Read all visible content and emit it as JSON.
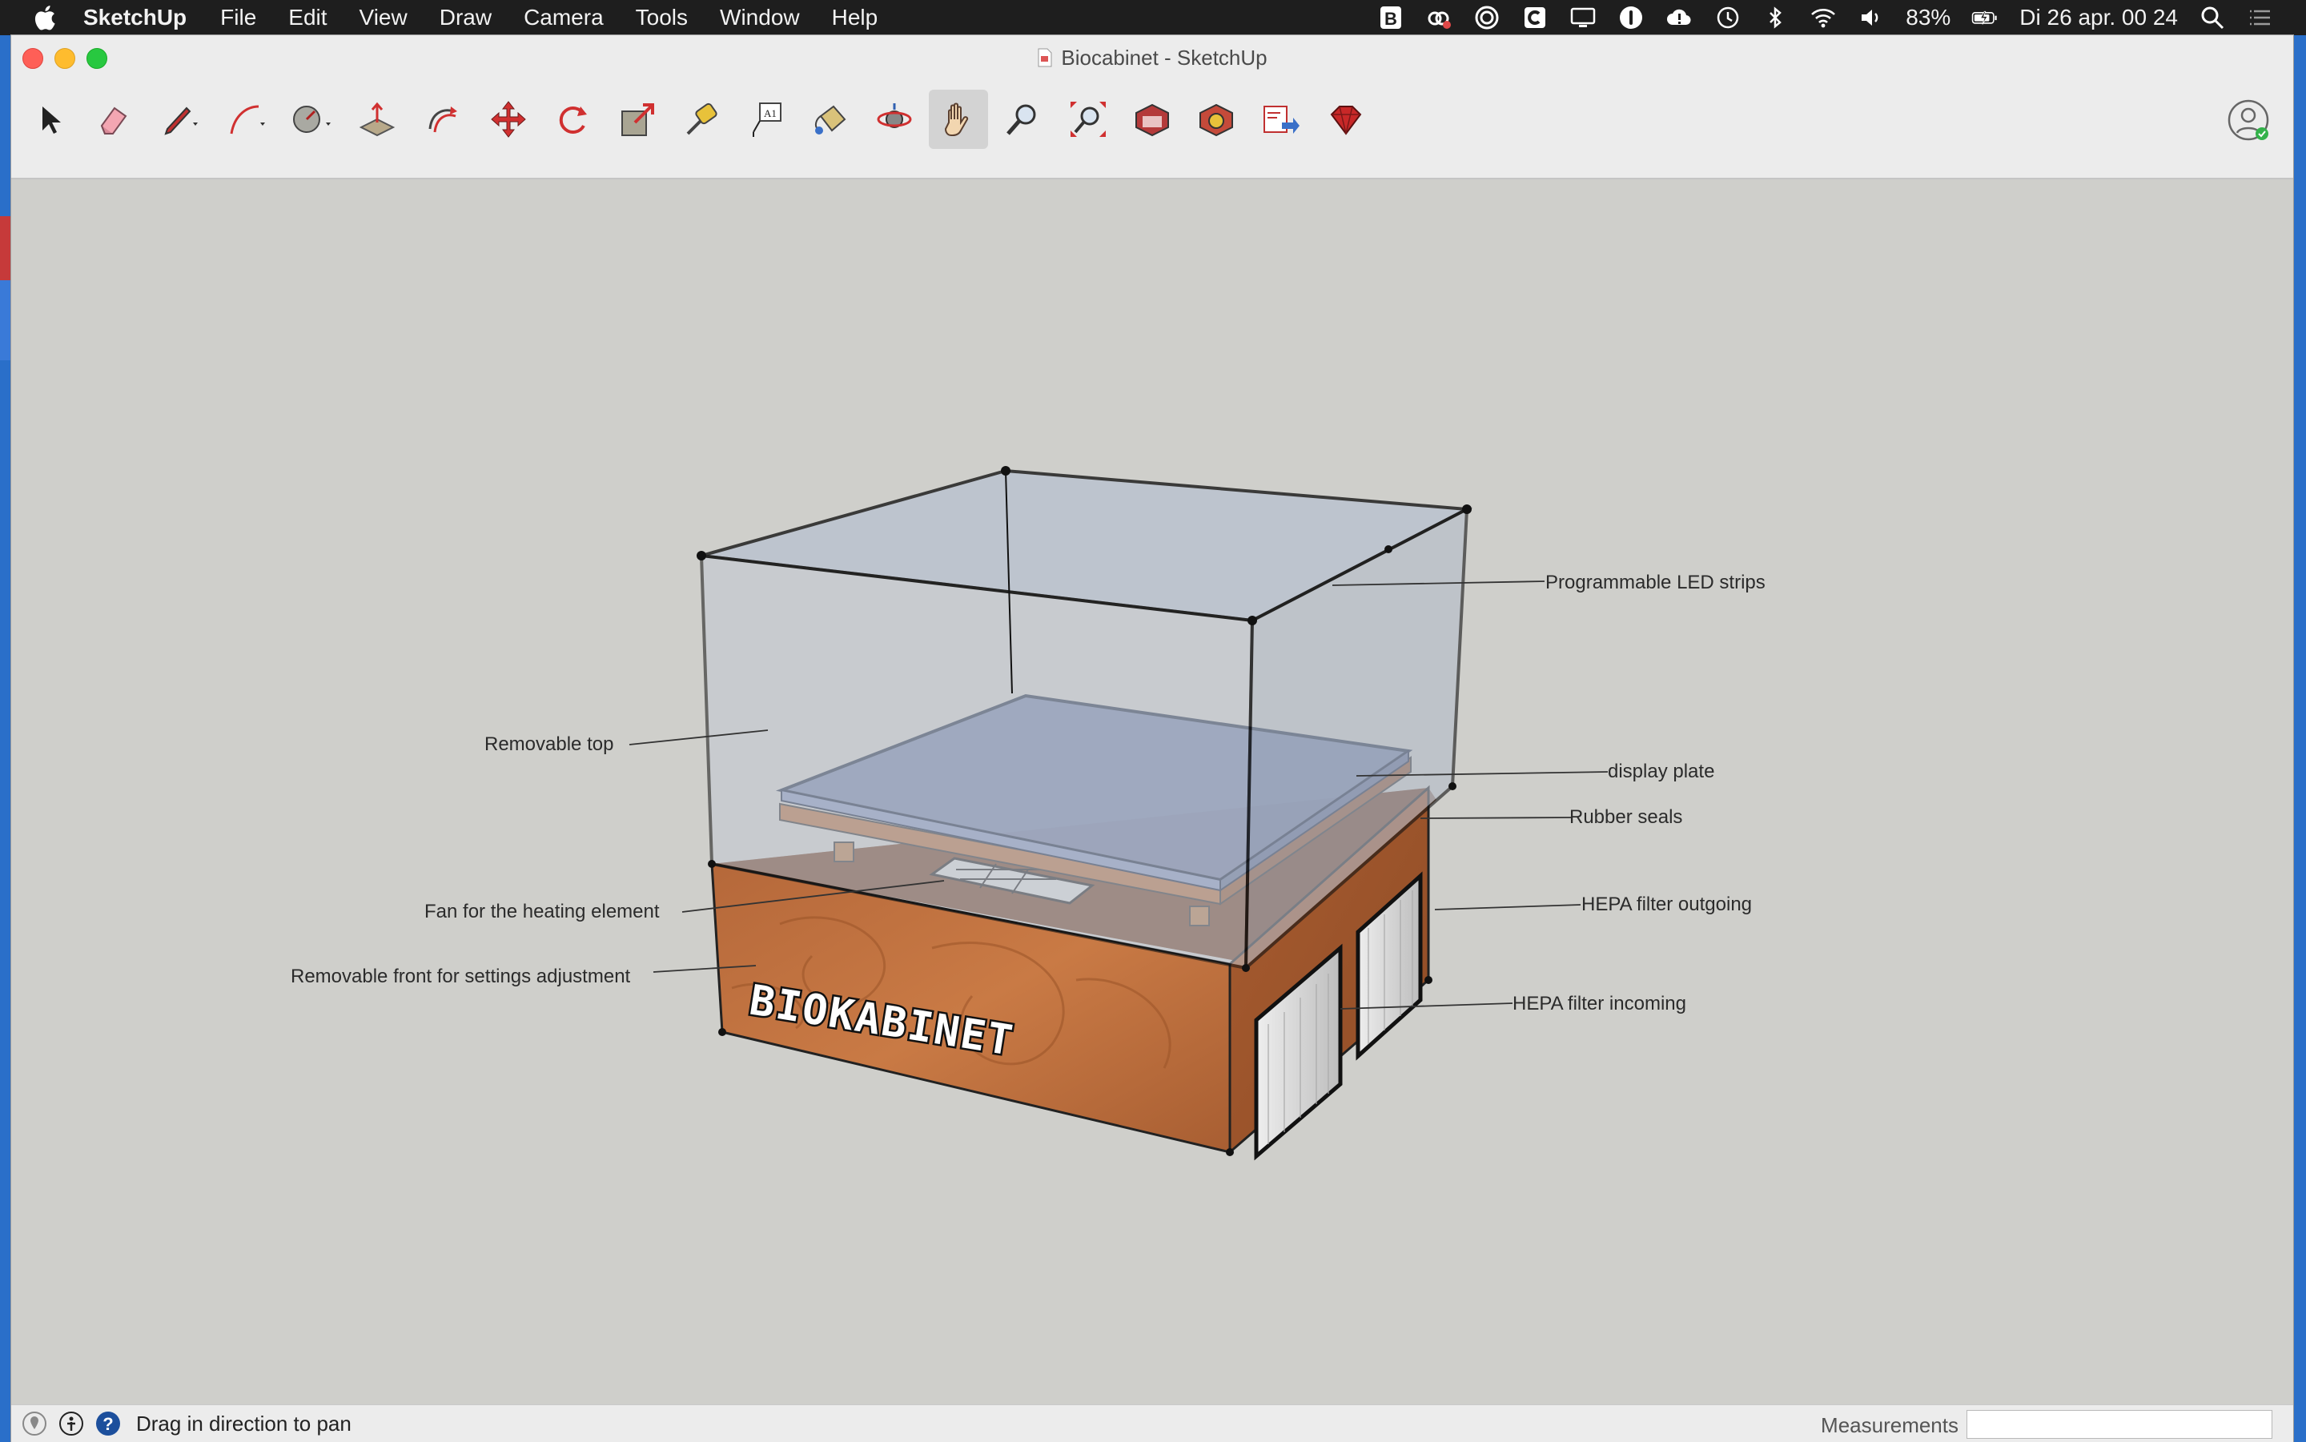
{
  "menubar": {
    "app_name": "SketchUp",
    "items": [
      "File",
      "Edit",
      "View",
      "Draw",
      "Camera",
      "Tools",
      "Window",
      "Help"
    ],
    "battery": "83%",
    "clock": "Di 26 apr.  00 24",
    "tray_icons": [
      "bold-b-icon",
      "creative-cloud-icon",
      "target-icon",
      "c-app-icon",
      "display-icon",
      "password-icon",
      "cloud-alert-icon",
      "time-machine-icon",
      "bluetooth-icon",
      "wifi-icon",
      "volume-icon",
      "battery-icon"
    ]
  },
  "window": {
    "title": "Biocabinet - SketchUp"
  },
  "toolbar": {
    "tools": [
      {
        "name": "select-tool-icon"
      },
      {
        "name": "eraser-tool-icon"
      },
      {
        "name": "line-tool-icon"
      },
      {
        "name": "arc-tool-icon"
      },
      {
        "name": "shapes-tool-icon"
      },
      {
        "name": "push-pull-tool-icon"
      },
      {
        "name": "offset-tool-icon"
      },
      {
        "name": "move-tool-icon"
      },
      {
        "name": "rotate-tool-icon"
      },
      {
        "name": "scale-tool-icon"
      },
      {
        "name": "tape-measure-tool-icon"
      },
      {
        "name": "text-tool-icon",
        "glyph": "A1"
      },
      {
        "name": "paint-bucket-tool-icon"
      },
      {
        "name": "orbit-tool-icon"
      },
      {
        "name": "pan-tool-icon",
        "active": true
      },
      {
        "name": "zoom-tool-icon"
      },
      {
        "name": "zoom-extents-tool-icon"
      },
      {
        "name": "3d-warehouse-icon"
      },
      {
        "name": "extension-warehouse-icon"
      },
      {
        "name": "send-to-layout-icon"
      },
      {
        "name": "extension-manager-icon"
      }
    ]
  },
  "model": {
    "label_text": "BIOKABINET",
    "colors": {
      "wood": "#b86a3a",
      "glass": "#aab4c8",
      "plate": "#6f7fa6",
      "filter": "#d8d8d8"
    }
  },
  "callouts": [
    {
      "id": "led",
      "text": "Programmable LED strips"
    },
    {
      "id": "top",
      "text": "Removable top"
    },
    {
      "id": "plate",
      "text": "display plate"
    },
    {
      "id": "seals",
      "text": "Rubber seals"
    },
    {
      "id": "fan",
      "text": "Fan for the heating element"
    },
    {
      "id": "hepa-out",
      "text": "HEPA filter outgoing"
    },
    {
      "id": "front",
      "text": "Removable front for settings adjustment"
    },
    {
      "id": "hepa-in",
      "text": "HEPA filter incoming"
    }
  ],
  "statusbar": {
    "message": "Drag in direction to pan",
    "measurements_label": "Measurements",
    "measurements_value": ""
  }
}
